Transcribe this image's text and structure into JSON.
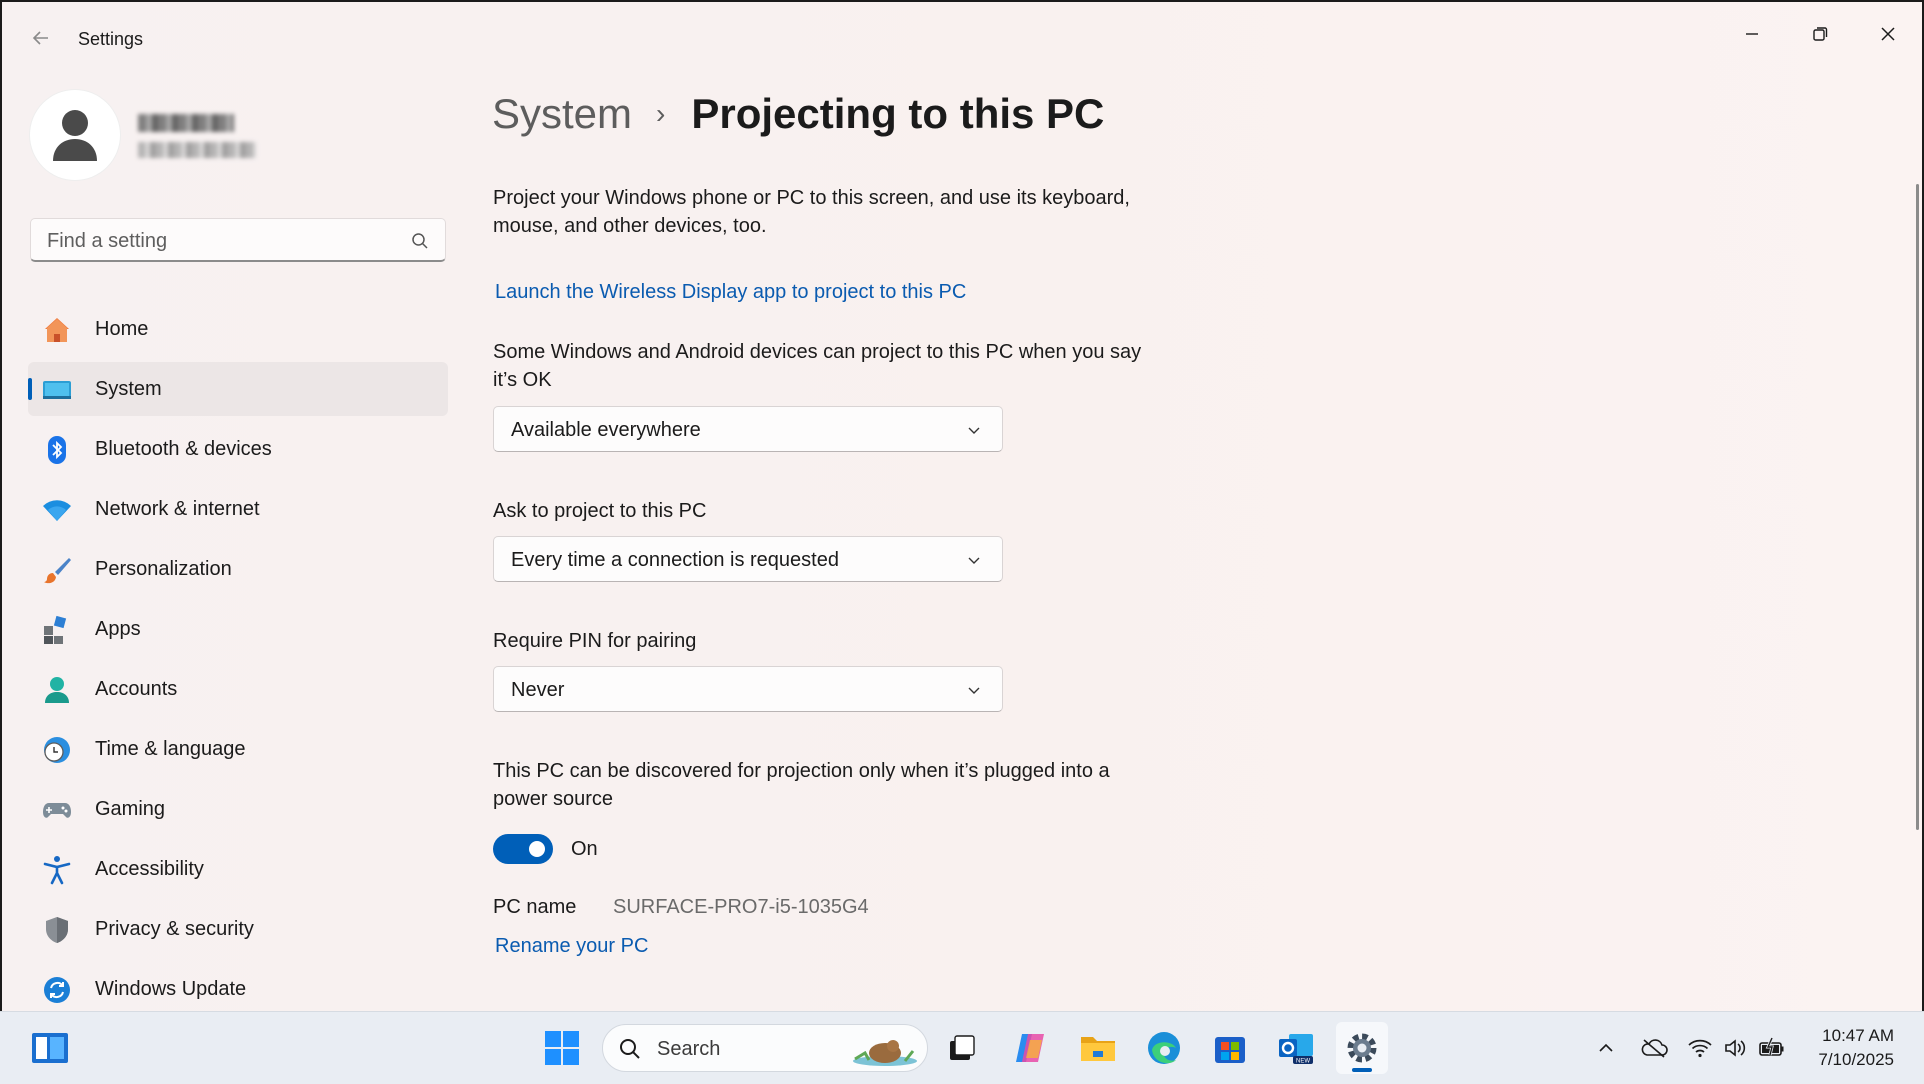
{
  "window": {
    "title": "Settings"
  },
  "search": {
    "placeholder": "Find a setting"
  },
  "sidebar": {
    "items": [
      {
        "label": "Home",
        "icon": "home-icon"
      },
      {
        "label": "System",
        "icon": "system-icon",
        "active": true
      },
      {
        "label": "Bluetooth & devices",
        "icon": "bluetooth-icon"
      },
      {
        "label": "Network & internet",
        "icon": "wifi-icon"
      },
      {
        "label": "Personalization",
        "icon": "brush-icon"
      },
      {
        "label": "Apps",
        "icon": "apps-icon"
      },
      {
        "label": "Accounts",
        "icon": "accounts-icon"
      },
      {
        "label": "Time & language",
        "icon": "clock-globe-icon"
      },
      {
        "label": "Gaming",
        "icon": "gamepad-icon"
      },
      {
        "label": "Accessibility",
        "icon": "accessibility-icon"
      },
      {
        "label": "Privacy & security",
        "icon": "shield-icon"
      },
      {
        "label": "Windows Update",
        "icon": "update-icon"
      }
    ]
  },
  "breadcrumb": {
    "parent": "System",
    "separator": "›",
    "current": "Projecting to this PC"
  },
  "main": {
    "intro": "Project your Windows phone or PC to this screen, and use its keyboard, mouse, and other devices, too.",
    "launch_link": "Launch the Wireless Display app to project to this PC",
    "availability_label": "Some Windows and Android devices can project to this PC when you say it’s OK",
    "availability_value": "Available everywhere",
    "ask_label": "Ask to project to this PC",
    "ask_value": "Every time a connection is requested",
    "pin_label": "Require PIN for pairing",
    "pin_value": "Never",
    "power_label": "This PC can be discovered for projection only when it’s plugged into a power source",
    "power_toggle_state": "On",
    "pc_name_label": "PC name",
    "pc_name_value": "SURFACE-PRO7-i5-1035G4",
    "rename_link": "Rename your PC"
  },
  "taskbar": {
    "search_label": "Search",
    "time": "10:47 AM",
    "date": "7/10/2025"
  },
  "colors": {
    "accent": "#005fb8",
    "link": "#0a5bb0"
  }
}
